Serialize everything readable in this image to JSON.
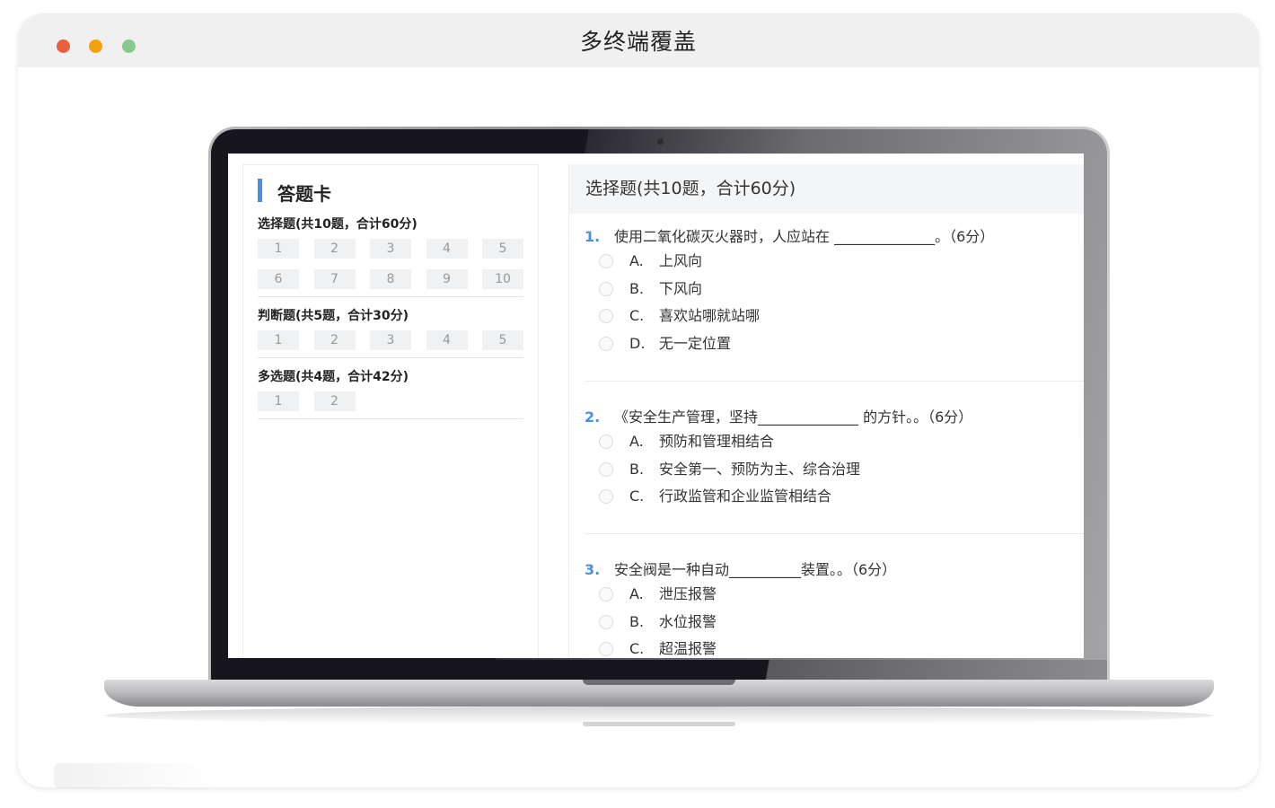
{
  "window": {
    "title": "多终端覆盖"
  },
  "answer_card": {
    "title": "答题卡",
    "sections": [
      {
        "title": "选择题(共10题，合计60分)",
        "numbers": [
          "1",
          "2",
          "3",
          "4",
          "5",
          "6",
          "7",
          "8",
          "9",
          "10"
        ]
      },
      {
        "title": "判断题(共5题，合计30分)",
        "numbers": [
          "1",
          "2",
          "3",
          "4",
          "5"
        ]
      },
      {
        "title": "多选题(共4题，合计42分)",
        "numbers": [
          "1",
          "2"
        ]
      }
    ]
  },
  "questions_panel": {
    "header": "选择题(共10题，合计60分)",
    "questions": [
      {
        "number": "1.",
        "text": "使用二氧化碳灭火器时，人应站在 ______________。（6分）",
        "options": [
          {
            "letter": "A.",
            "text": "上风向"
          },
          {
            "letter": "B.",
            "text": "下风向"
          },
          {
            "letter": "C.",
            "text": "喜欢站哪就站哪"
          },
          {
            "letter": "D.",
            "text": "无一定位置"
          }
        ]
      },
      {
        "number": "2.",
        "text": "《安全生产管理，坚持______________ 的方针。。（6分）",
        "options": [
          {
            "letter": "A.",
            "text": "预防和管理相结合"
          },
          {
            "letter": "B.",
            "text": "安全第一、预防为主、综合治理"
          },
          {
            "letter": "C.",
            "text": "行政监管和企业监管相结合"
          }
        ]
      },
      {
        "number": "3.",
        "text": "安全阀是一种自动__________装置。。（6分）",
        "options": [
          {
            "letter": "A.",
            "text": "泄压报警"
          },
          {
            "letter": "B.",
            "text": "水位报警"
          },
          {
            "letter": "C.",
            "text": "超温报警"
          }
        ]
      }
    ]
  },
  "colors": {
    "accent": "#4a90e2",
    "traffic_red": "#e9603f",
    "traffic_yellow": "#f4a20b",
    "traffic_green": "#86c98f"
  }
}
